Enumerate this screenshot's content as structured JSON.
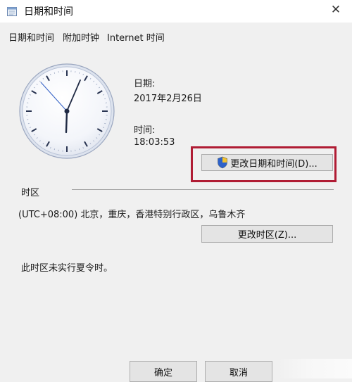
{
  "window": {
    "title": "日期和时间",
    "close_glyph": "✕"
  },
  "tabs": [
    {
      "label": "日期和时间"
    },
    {
      "label": "附加时钟"
    },
    {
      "label": "Internet 时间"
    }
  ],
  "date": {
    "label": "日期:",
    "value": "2017年2月26日"
  },
  "time": {
    "label": "时间:",
    "value": "18:03:53",
    "hours": 18,
    "minutes": 3,
    "seconds": 53
  },
  "buttons": {
    "change_datetime": "更改日期和时间(D)...",
    "change_timezone": "更改时区(Z)...",
    "ok": "确定",
    "cancel": "取消"
  },
  "timezone": {
    "section_label": "时区",
    "value": "(UTC+08:00) 北京，重庆，香港特别行政区，乌鲁木齐",
    "dst_note": "此时区未实行夏令时。"
  },
  "colors": {
    "highlight_border": "#b01c34",
    "window_bg": "#f0f0f0"
  }
}
